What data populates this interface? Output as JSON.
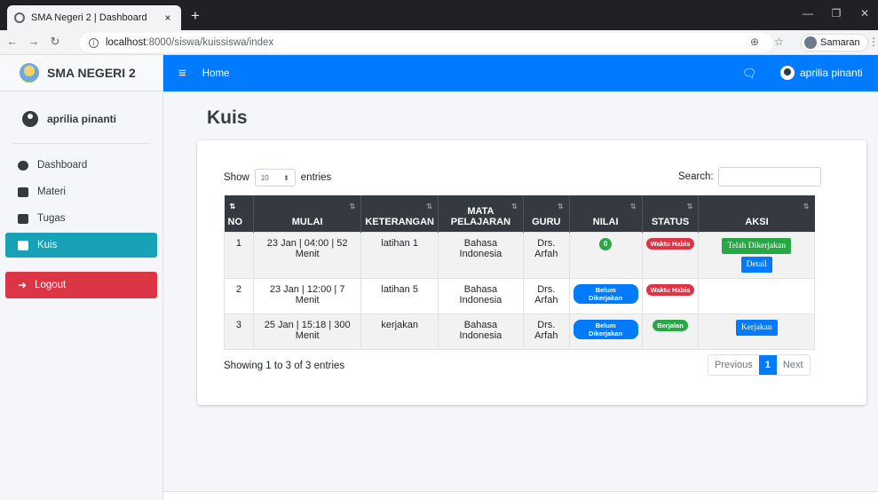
{
  "browser": {
    "tab_title": "SMA Negeri 2 | Dashboard",
    "tab_close": "×",
    "new_tab": "+",
    "url_host": "localhost",
    "url_path": ":8000/siswa/kuissiswa/index",
    "profile_name": "Samaran"
  },
  "sidebar": {
    "brand": "SMA NEGERI 2",
    "user_name": "aprilia pinanti",
    "items": [
      {
        "label": "Dashboard",
        "icon": "dashboard-icon"
      },
      {
        "label": "Materi",
        "icon": "book-icon"
      },
      {
        "label": "Tugas",
        "icon": "book-icon"
      },
      {
        "label": "Kuis",
        "icon": "book-icon",
        "active": true
      }
    ],
    "logout_label": "Logout"
  },
  "topnav": {
    "home_label": "Home",
    "user_name": "aprilia pinanti"
  },
  "page_title": "Kuis",
  "table_controls": {
    "show_label": "Show",
    "entries_label": "entries",
    "length_value": "10",
    "search_label": "Search:"
  },
  "table": {
    "headers": [
      "NO",
      "MULAI",
      "KETERANGAN",
      "MATA PELAJARAN",
      "GURU",
      "NILAI",
      "STATUS",
      "AKSI"
    ],
    "rows": [
      {
        "no": "1",
        "mulai": "23 Jan | 04:00 | 52 Menit",
        "keterangan": "latihan 1",
        "mapel": "Bahasa Indonesia",
        "guru": "Drs. Arfah",
        "nilai": "0",
        "status": "Waktu Habis",
        "aksi1": "Telah Dikerjakan",
        "aksi2": "Detail"
      },
      {
        "no": "2",
        "mulai": "23 Jan | 12:00 | 7 Menit",
        "keterangan": "latihan 5",
        "mapel": "Bahasa Indonesia",
        "guru": "Drs. Arfah",
        "nilai": "Belum Dikerjakan",
        "status": "Waktu Habis"
      },
      {
        "no": "3",
        "mulai": "25 Jan | 15:18 | 300 Menit",
        "keterangan": "kerjakan",
        "mapel": "Bahasa Indonesia",
        "guru": "Drs. Arfah",
        "nilai": "Belum Dikerjakan",
        "status": "Berjalan",
        "aksi1": "Kerjakan"
      }
    ]
  },
  "footer_info": "Showing 1 to 3 of 3 entries",
  "pagination": {
    "previous": "Previous",
    "current": "1",
    "next": "Next"
  },
  "colors": {
    "primary": "#007bff",
    "info": "#17a2b8",
    "danger": "#dc3545",
    "success": "#28a745",
    "dark": "#343a40"
  }
}
